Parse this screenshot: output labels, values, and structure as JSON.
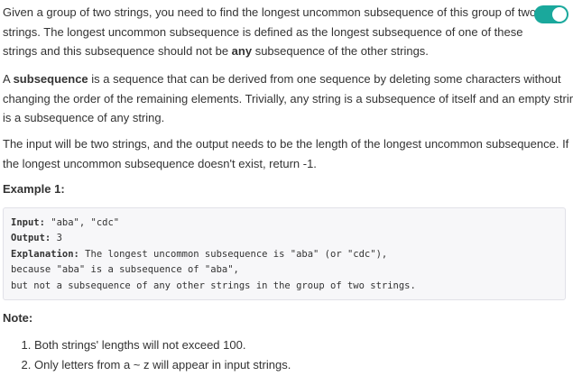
{
  "description": {
    "intro_lines": [
      "Given a group of two strings, you need to find the longest uncommon subsequence of this group of two",
      "strings. The longest uncommon subsequence is defined as the longest subsequence of one of these"
    ],
    "intro_line3_before": "strings and this subsequence should not be ",
    "intro_line3_bold": "any",
    "intro_line3_after": " subsequence of the other strings.",
    "def_line1_before": "A ",
    "def_line1_bold": "subsequence",
    "def_line1_after": " is a sequence that can be derived from one sequence by deleting some characters without",
    "def_lines": [
      "changing the order of the remaining elements. Trivially, any string is a subsequence of itself and an empty string",
      "is a subsequence of any string."
    ],
    "io_lines": [
      "The input will be two strings, and the output needs to be the length of the longest uncommon subsequence. If",
      "the longest uncommon subsequence doesn't exist, return -1."
    ]
  },
  "example": {
    "heading": "Example 1:",
    "input_label": "Input:",
    "input_value": " \"aba\", \"cdc\"",
    "output_label": "Output:",
    "output_value": " 3",
    "explanation_label": "Explanation:",
    "explanation_value": " The longest uncommon subsequence is \"aba\" (or \"cdc\"),",
    "explanation_cont": [
      "because \"aba\" is a subsequence of \"aba\",",
      "but not a subsequence of any other strings in the group of two strings."
    ]
  },
  "note": {
    "heading": "Note:",
    "items": [
      "Both strings' lengths will not exceed 100.",
      "Only letters from a ~ z will appear in input strings."
    ]
  },
  "toggle": {
    "state": "on",
    "color": "#1aa89c",
    "icon": "toggle-switch-icon"
  }
}
